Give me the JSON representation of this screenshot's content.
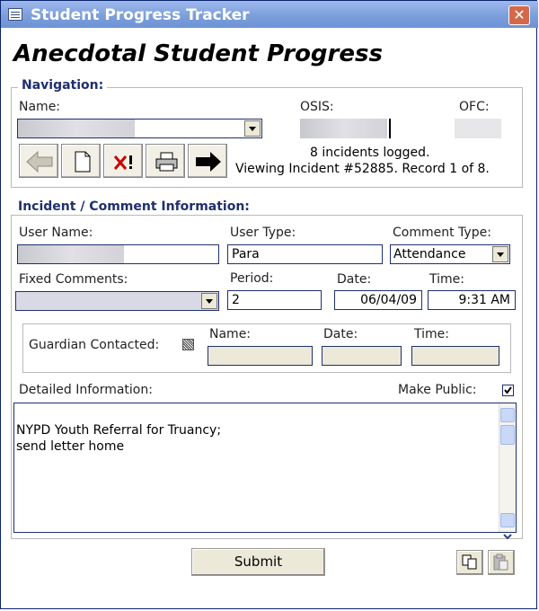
{
  "window": {
    "title": "Student Progress Tracker",
    "close_symbol": "✕"
  },
  "heading": "Anecdotal Student Progress",
  "navigation": {
    "legend": "Navigation:",
    "name_label": "Name:",
    "osis_label": "OSIS:",
    "ofc_label": "OFC:",
    "incidents_logged": "8 incidents logged.",
    "viewing_text": "Viewing Incident #52885. Record 1 of 8.",
    "buttons": [
      "previous-record",
      "new-record",
      "delete-record",
      "print",
      "next-record"
    ]
  },
  "incident": {
    "legend": "Incident / Comment Information:",
    "user_name_label": "User Name:",
    "user_type_label": "User Type:",
    "user_type_value": "Para",
    "comment_type_label": "Comment Type:",
    "comment_type_value": "Attendance",
    "fixed_comments_label": "Fixed Comments:",
    "period_label": "Period:",
    "period_value": "2",
    "date_label": "Date:",
    "date_value": "06/04/09",
    "time_label": "Time:",
    "time_value": "9:31 AM"
  },
  "guardian": {
    "label": "Guardian Contacted:",
    "name_label": "Name:",
    "date_label": "Date:",
    "time_label": "Time:"
  },
  "details": {
    "label": "Detailed Information:",
    "make_public_label": "Make Public:",
    "make_public_checked": true,
    "text": "NYPD Youth Referral for Truancy;\nsend letter home"
  },
  "footer": {
    "submit_label": "Submit",
    "copy_icon": "copy-icon",
    "paste_icon": "paste-icon"
  },
  "colors": {
    "title_bar": "#7c9fdb",
    "legend_text": "#1f2f6e",
    "field_border": "#1f2f6e",
    "close_button": "#d4694a"
  }
}
